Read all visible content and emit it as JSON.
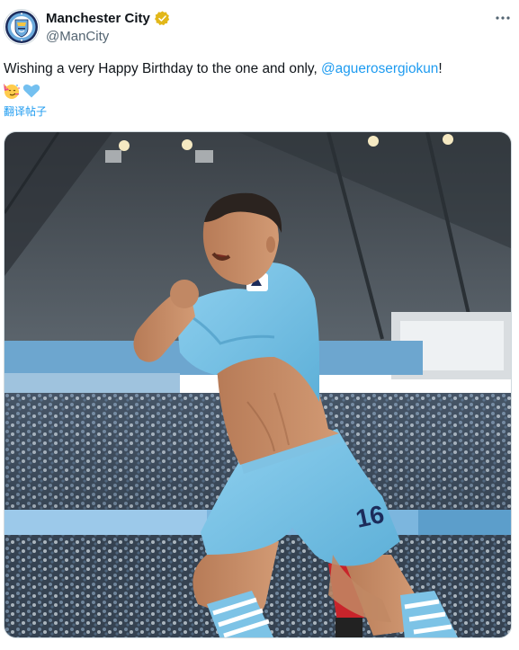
{
  "author": {
    "display_name": "Manchester City",
    "handle": "@ManCity",
    "avatar_icon": "man-city-crest-icon",
    "verified_icon": "gold-verified-badge-icon",
    "verified_color": "#e2b719"
  },
  "tweet": {
    "text_before": "Wishing a very Happy Birthday to the one and only, ",
    "mention": "@aguerosergiokun",
    "text_after": "!",
    "emojis": [
      "partying-face-emoji",
      "light-blue-heart-emoji"
    ],
    "translate_label": "翻译帖子"
  },
  "menu": {
    "more_icon": "more-options-icon"
  },
  "media": {
    "description_icon": "celebrating-player-photo",
    "shirt_number": "16",
    "colors": {
      "sky_blue": "#6cabdd",
      "link": "#1d9bf0"
    }
  }
}
